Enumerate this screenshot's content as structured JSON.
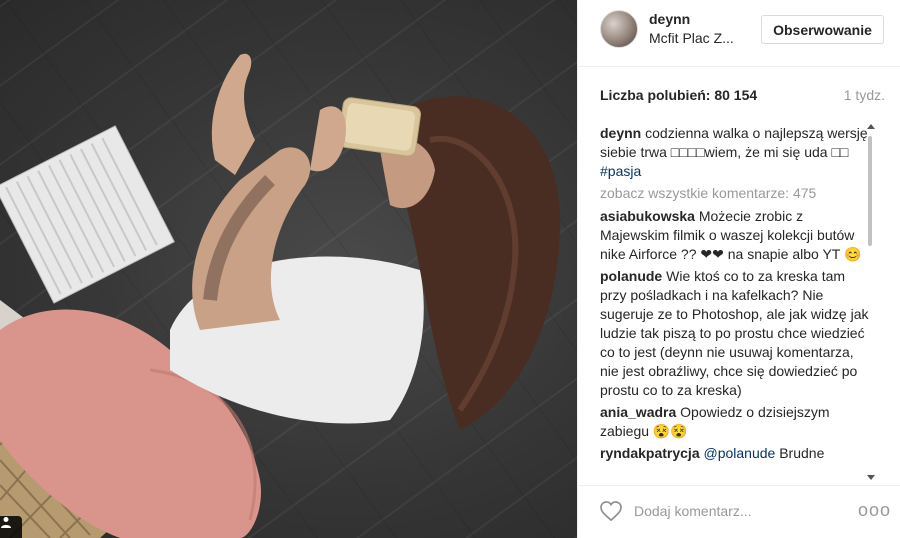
{
  "post": {
    "username": "deynn",
    "location": "Mcfit Plac Z...",
    "follow_label": "Obserwowanie",
    "likes": "Liczba polubień: 80 154",
    "time_ago": "1 tydz.",
    "comment_placeholder": "Dodaj komentarz...",
    "more_label": "ooo"
  },
  "caption": {
    "user": "deynn",
    "text": "codzienna walka o najlepszą wersję siebie trwa □□□□wiem, że mi się uda □□",
    "hashtag": "#pasja"
  },
  "view_all": "zobacz wszystkie komentarze: 475",
  "comments": [
    {
      "user": "asiabukowska",
      "text": "Możecie zrobic z Majewskim filmik o waszej kolekcji butów nike Airforce ?? ❤❤ na snapie albo YT 😊"
    },
    {
      "user": "polanude",
      "text": "Wie ktoś co to za kreska tam przy pośladkach i na kafelkach? Nie sugeruje ze to Photoshop, ale jak widzę jak ludzie tak piszą to po prostu chce wiedzieć co to jest (deynn nie usuwaj komentarza, nie jest obraźliwy, chce się dowiedzieć po prostu co to za kreska)"
    },
    {
      "user": "ania_wadra",
      "text": "Opowiedz o dzisiejszym zabiegu 😵😵"
    },
    {
      "user": "ryndakpatrycja",
      "mention": "@polanude",
      "text": "Brudne"
    }
  ],
  "icons": {
    "heart": "heart-outline",
    "tag": "user-tag",
    "scroll_up": "triangle-up",
    "scroll_down": "triangle-down"
  }
}
